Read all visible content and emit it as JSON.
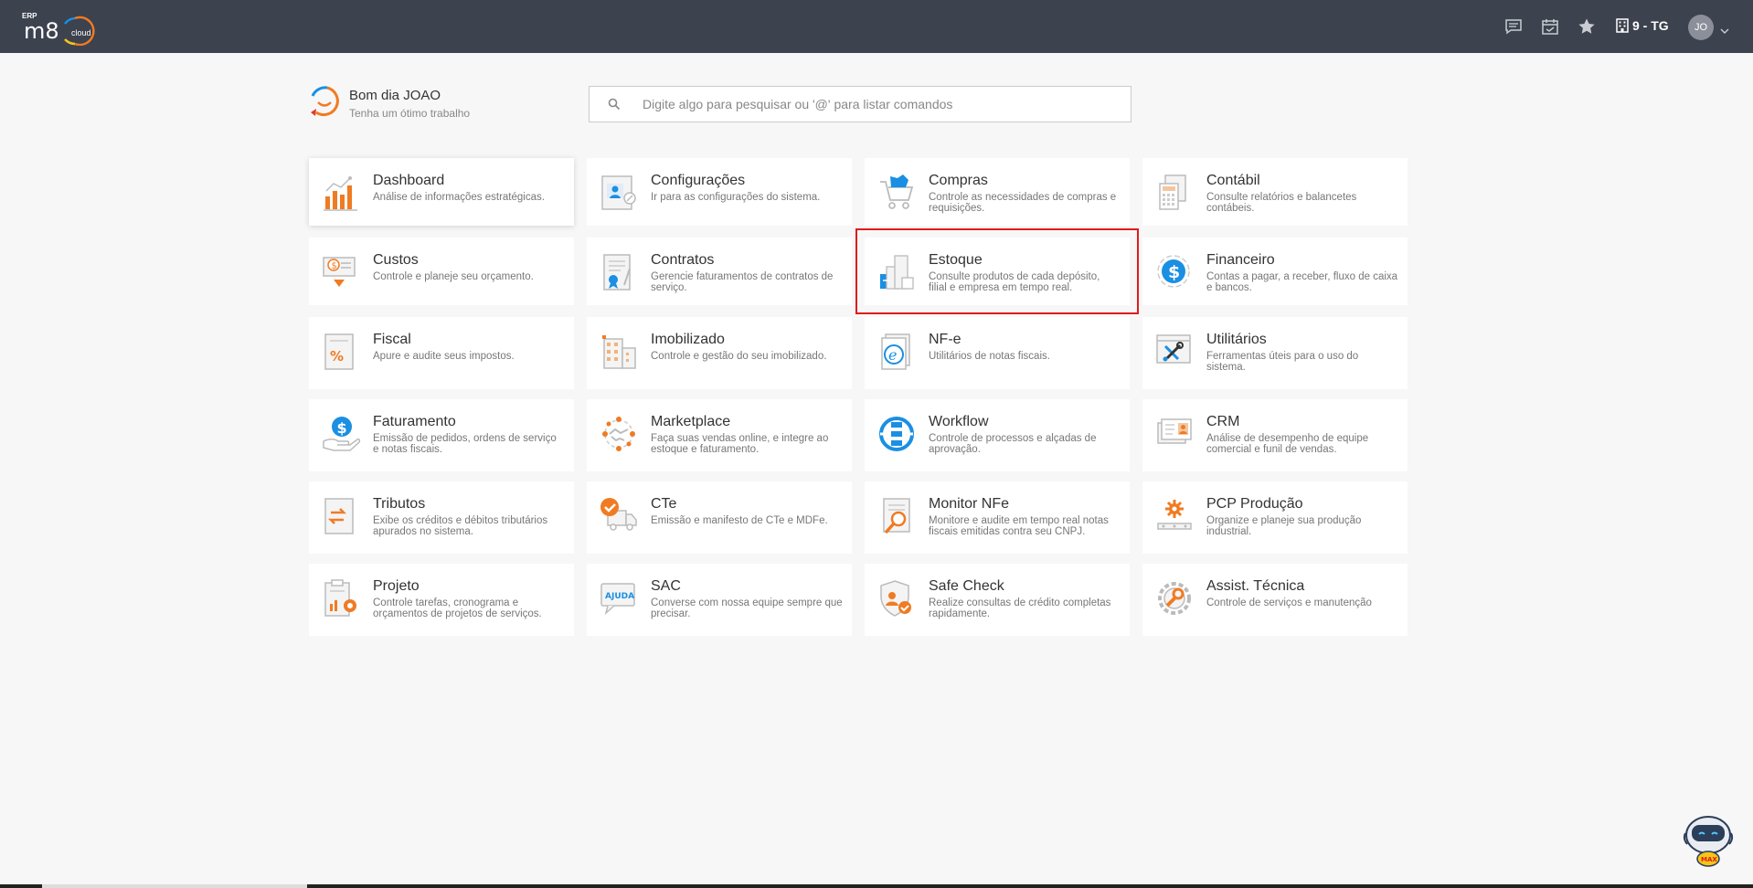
{
  "header": {
    "logo_erp": "ERP",
    "logo_m8": "m8",
    "logo_cloud": "cloud",
    "company": "9 - TG",
    "avatar": "JO"
  },
  "greeting": {
    "title": "Bom dia JOAO",
    "subtitle": "Tenha um ótimo trabalho"
  },
  "search": {
    "placeholder": "Digite algo para pesquisar ou '@' para listar comandos"
  },
  "modules": [
    {
      "title": "Dashboard",
      "desc": "Análise de informações estratégicas."
    },
    {
      "title": "Configurações",
      "desc": "Ir para as configurações do sistema."
    },
    {
      "title": "Compras",
      "desc": "Controle as necessidades de compras e requisições."
    },
    {
      "title": "Contábil",
      "desc": "Consulte relatórios e balancetes contábeis."
    },
    {
      "title": "Custos",
      "desc": "Controle e planeje seu orçamento."
    },
    {
      "title": "Contratos",
      "desc": "Gerencie faturamentos de contratos de serviço."
    },
    {
      "title": "Estoque",
      "desc": "Consulte produtos de cada depósito, filial e empresa em tempo real."
    },
    {
      "title": "Financeiro",
      "desc": "Contas a pagar, a receber, fluxo de caixa e bancos."
    },
    {
      "title": "Fiscal",
      "desc": "Apure e audite seus impostos."
    },
    {
      "title": "Imobilizado",
      "desc": "Controle e gestão do seu imobilizado."
    },
    {
      "title": "NF-e",
      "desc": "Utilitários de notas fiscais."
    },
    {
      "title": "Utilitários",
      "desc": "Ferramentas úteis para o uso do sistema."
    },
    {
      "title": "Faturamento",
      "desc": "Emissão de pedidos, ordens de serviço e notas fiscais."
    },
    {
      "title": "Marketplace",
      "desc": "Faça suas vendas online, e integre ao estoque e faturamento."
    },
    {
      "title": "Workflow",
      "desc": "Controle de processos e alçadas de aprovação."
    },
    {
      "title": "CRM",
      "desc": "Análise de desempenho de equipe comercial e funil de vendas."
    },
    {
      "title": "Tributos",
      "desc": "Exibe os créditos e débitos tributários apurados no sistema."
    },
    {
      "title": "CTe",
      "desc": "Emissão e manifesto de CTe e MDFe."
    },
    {
      "title": "Monitor NFe",
      "desc": "Monitore e audite em tempo real notas fiscais emitidas contra seu CNPJ."
    },
    {
      "title": "PCP Produção",
      "desc": "Organize e planeje sua produção industrial."
    },
    {
      "title": "Projeto",
      "desc": "Controle tarefas, cronograma e orçamentos de projetos de serviços."
    },
    {
      "title": "SAC",
      "desc": "Converse com nossa equipe sempre que precisar."
    },
    {
      "title": "Safe Check",
      "desc": "Realize consultas de crédito completas rapidamente."
    },
    {
      "title": "Assist. Técnica",
      "desc": "Controle de serviços e manutenção"
    }
  ],
  "sac_badge": "AJUDA",
  "robot_label": "MAX",
  "colors": {
    "topbar": "#3c424e",
    "orange": "#f07b22",
    "blue": "#1a8fe3",
    "highlight": "#e01b1b"
  }
}
